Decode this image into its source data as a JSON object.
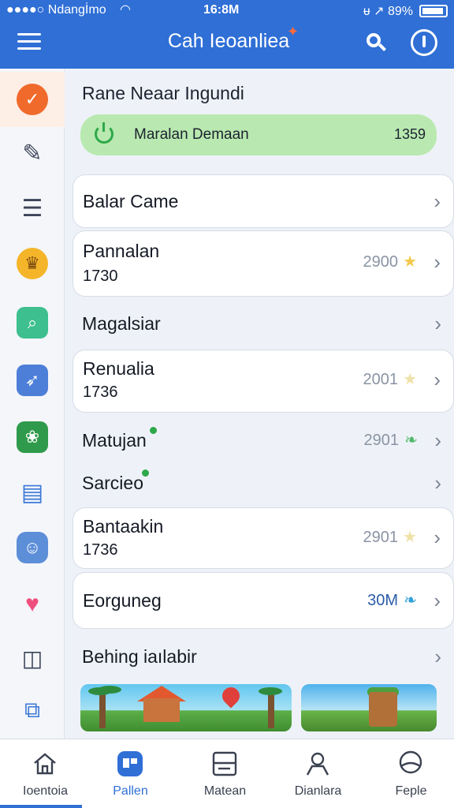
{
  "status": {
    "carrier": "●●●●○ Ndangİmo",
    "time": "16:8M",
    "right": "ᵾ ↗ 89%"
  },
  "header": {
    "title": "Cah Ieoanliea",
    "search_icon": "search-icon",
    "power_icon": "power-icon",
    "menu_icon": "menu-icon"
  },
  "rail": [
    "check-icon",
    "pencil-icon",
    "list-icon",
    "lamp-icon",
    "search-icon",
    "rocket-icon",
    "garden-icon",
    "folder-icon",
    "avatar-icon",
    "heart-icon",
    "screen-icon",
    "badge-icon"
  ],
  "section": {
    "title": "Rane Neaar Ingundi"
  },
  "status_pill": {
    "label": "Maralan  Demaan",
    "value": "1359"
  },
  "rows": [
    {
      "name": "Balar Came"
    },
    {
      "name": "Pannalan",
      "sub": "1730",
      "score": "2900"
    },
    {
      "name": "Magalsiar"
    },
    {
      "name": "Renualia",
      "sub": "1736",
      "score": "2001"
    },
    {
      "name": "Matujan",
      "score": "2901"
    },
    {
      "name": "Sarcieo"
    },
    {
      "name": "Bantaakin",
      "sub": "1736",
      "score": "2901"
    },
    {
      "name": "Eorguneg",
      "score": "30M"
    },
    {
      "name": "Behing iaılabir"
    }
  ],
  "tabs": [
    {
      "label": "Ioentoia",
      "icon": "home-icon"
    },
    {
      "label": "Pallen",
      "icon": "grid-icon"
    },
    {
      "label": "Matean",
      "icon": "card-icon"
    },
    {
      "label": "Dianlara",
      "icon": "person-icon"
    },
    {
      "label": "Feple",
      "icon": "profile-icon"
    }
  ],
  "colors": {
    "accent": "#2f6fd6",
    "pill": "#b9e9b0",
    "star": "#f2c94c"
  }
}
